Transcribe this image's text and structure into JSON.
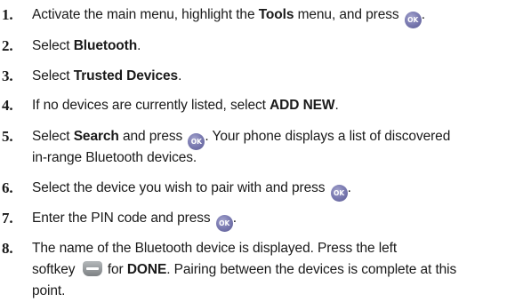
{
  "steps": [
    {
      "number": "1.",
      "lines": [
        [
          {
            "t": "Activate the main menu, highlight the "
          },
          {
            "t": "Tools",
            "b": true
          },
          {
            "t": " menu, and press "
          },
          {
            "icon": "ok-icon",
            "t": "OK"
          },
          {
            "t": "."
          }
        ]
      ]
    },
    {
      "number": "2.",
      "lines": [
        [
          {
            "t": "Select "
          },
          {
            "t": "Bluetooth",
            "b": true
          },
          {
            "t": "."
          }
        ]
      ]
    },
    {
      "number": "3.",
      "lines": [
        [
          {
            "t": "Select "
          },
          {
            "t": "Trusted Devices",
            "b": true
          },
          {
            "t": "."
          }
        ]
      ]
    },
    {
      "number": "4.",
      "lines": [
        [
          {
            "t": "If no devices are currently listed, select "
          },
          {
            "t": "ADD NEW",
            "b": true
          },
          {
            "t": "."
          }
        ]
      ]
    },
    {
      "number": "5.",
      "lines": [
        [
          {
            "t": "Select "
          },
          {
            "t": "Search",
            "b": true
          },
          {
            "t": " and press "
          },
          {
            "icon": "ok-icon",
            "t": "OK"
          },
          {
            "t": ". Your phone displays a list of discovered"
          }
        ],
        [
          {
            "t": "in-range Bluetooth devices."
          }
        ]
      ]
    },
    {
      "number": "6.",
      "lines": [
        [
          {
            "t": "Select the device you wish to pair with and press "
          },
          {
            "icon": "ok-icon",
            "t": "OK"
          },
          {
            "t": "."
          }
        ]
      ]
    },
    {
      "number": "7.",
      "lines": [
        [
          {
            "t": "Enter the PIN code and press "
          },
          {
            "icon": "ok-icon",
            "t": "OK"
          },
          {
            "t": "."
          }
        ]
      ]
    },
    {
      "number": "8.",
      "lines": [
        [
          {
            "t": "The name of the Bluetooth device is displayed. Press the left"
          }
        ],
        [
          {
            "t": "softkey "
          },
          {
            "icon": "left-softkey-icon"
          },
          {
            "t": " for "
          },
          {
            "t": "DONE",
            "b": true
          },
          {
            "t": ". Pairing between the devices is complete at this"
          }
        ],
        [
          {
            "t": "point."
          }
        ]
      ]
    }
  ]
}
